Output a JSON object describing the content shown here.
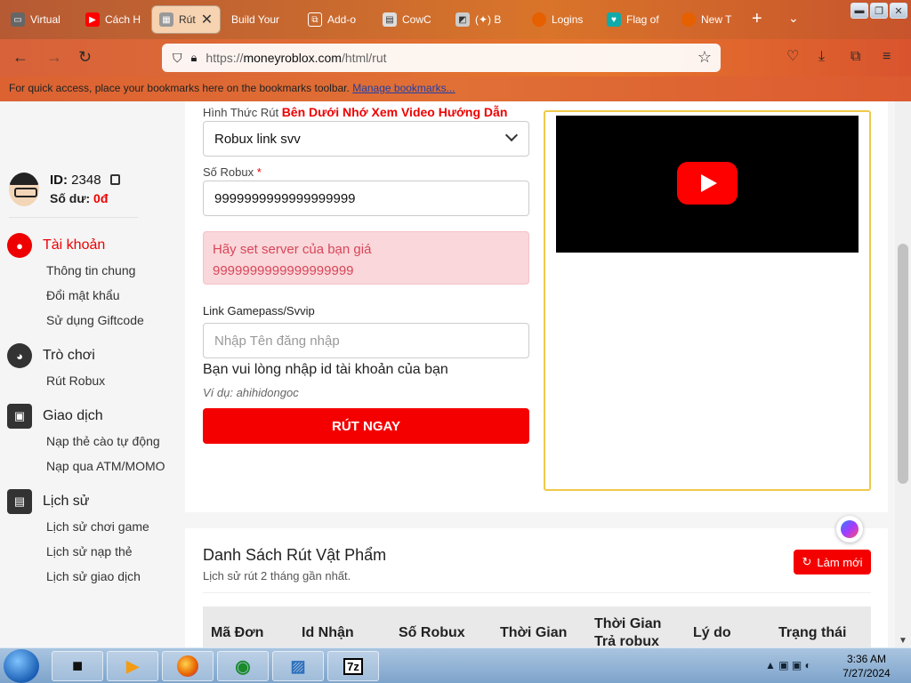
{
  "browser": {
    "tabs": [
      {
        "label": "Virtual"
      },
      {
        "label": "Cách H"
      },
      {
        "label": "Rút"
      },
      {
        "label": "Build Your"
      },
      {
        "label": "Add-o"
      },
      {
        "label": "CowC"
      },
      {
        "label": "(✦) B"
      },
      {
        "label": "Logins"
      },
      {
        "label": "Flag of"
      },
      {
        "label": "New T"
      }
    ],
    "url_proto": "https://",
    "url_host": "moneyroblox.com",
    "url_path": "/html/rut",
    "bookmarks_text": "For quick access, place your bookmarks here on the bookmarks toolbar.",
    "bookmarks_link": "Manage bookmarks..."
  },
  "sidebar": {
    "id_label": "ID:",
    "id_value": "2348",
    "balance_label": "Số dư:",
    "balance_value": "0đ",
    "groups": [
      {
        "title": "Tài khoản",
        "items": [
          "Thông tin chung",
          "Đổi mật khẩu",
          "Sử dụng Giftcode"
        ]
      },
      {
        "title": "Trò chơi",
        "items": [
          "Rút Robux"
        ]
      },
      {
        "title": "Giao dịch",
        "items": [
          "Nạp thẻ cào tự động",
          "Nạp qua ATM/MOMO"
        ]
      },
      {
        "title": "Lịch sử",
        "items": [
          "Lịch sử chơi game",
          "Lịch sử nạp thẻ",
          "Lịch sử giao dịch"
        ]
      }
    ]
  },
  "form": {
    "method_label": "Hình Thức Rút",
    "method_hint": "Bên Dưới Nhớ Xem Video Hướng Dẫn",
    "method_value": "Robux link svv",
    "robux_label": "Số Robux",
    "required_mark": "*",
    "robux_value": "9999999999999999999",
    "alert_text": "Hãy set server của bạn giá",
    "alert_value": "9999999999999999999",
    "link_label": "Link Gamepass/Svvip",
    "link_placeholder": "Nhập Tên đăng nhập",
    "help_text": "Bạn vui lòng nhập id tài khoản của bạn",
    "example_text": "Ví dụ: ahihidongoc",
    "submit_label": "RÚT NGAY"
  },
  "list": {
    "title": "Danh Sách Rút Vật Phẩm",
    "subtitle": "Lịch sử rút 2 tháng gần nhất.",
    "refresh_label": "Làm mới",
    "columns": [
      "Mã Đơn",
      "Id Nhận",
      "Số Robux",
      "Thời Gian",
      "Thời Gian Trả robux",
      "Lý do",
      "Trạng thái"
    ]
  },
  "taskbar": {
    "time": "3:36 AM",
    "date": "7/27/2024"
  },
  "colors": {
    "accent": "#f50000",
    "alert_bg": "#f9d7da",
    "video_border": "#f0c94a"
  }
}
